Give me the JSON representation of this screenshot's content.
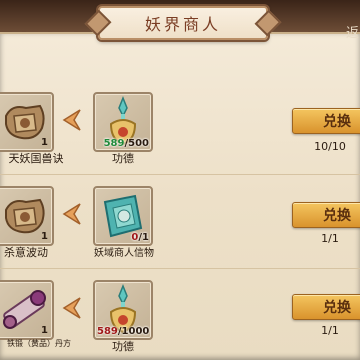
{
  "title": "妖界商人",
  "close_hint": "返",
  "exchange_label": "兑换",
  "rows": [
    {
      "target": {
        "name": "天妖国兽诀",
        "count": "1",
        "icon": "beast-tome-icon"
      },
      "cost": {
        "name": "功德",
        "current": "589",
        "required": "/500",
        "icon": "merit-scepter-icon"
      },
      "limit": "10/10"
    },
    {
      "target": {
        "name": "杀意波动",
        "count": "1",
        "icon": "killing-intent-tome-icon"
      },
      "cost": {
        "name": "妖域商人信物",
        "current": "0",
        "required": "/1",
        "icon": "merchant-token-icon"
      },
      "limit": "1/1"
    },
    {
      "target": {
        "name": "铁锻（黄品）丹方",
        "count": "1",
        "icon": "recipe-scroll-icon"
      },
      "cost": {
        "name": "功德",
        "current": "589",
        "required": "/1000",
        "icon": "merit-scepter-icon"
      },
      "limit": "1/1"
    }
  ]
}
